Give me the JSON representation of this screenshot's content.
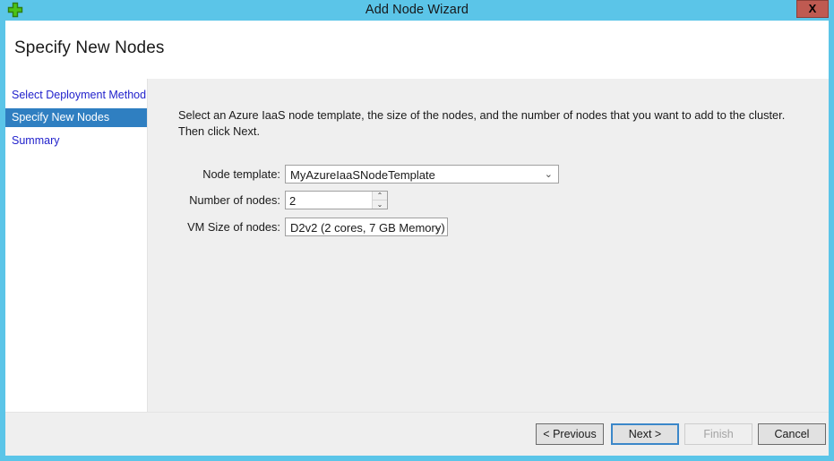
{
  "window": {
    "title": "Add Node Wizard",
    "icon": "green-plus-icon",
    "close_label": "X",
    "titlebar_color": "#5bc5e8",
    "close_button_color": "#bf5a51"
  },
  "header": {
    "page_title": "Specify New Nodes"
  },
  "sidebar": {
    "selected_index": 1,
    "highlight_color": "#2f7fc1",
    "link_color": "#2222cc",
    "items": [
      {
        "label": "Select Deployment Method"
      },
      {
        "label": "Specify New Nodes"
      },
      {
        "label": "Summary"
      }
    ]
  },
  "content": {
    "intro": "Select an Azure IaaS node template, the size of the nodes, and the number of nodes that you want to add to the cluster. Then click Next.",
    "fields": {
      "node_template": {
        "label": "Node template:",
        "value": "MyAzureIaaSNodeTemplate",
        "chevron": "⌄"
      },
      "number_of_nodes": {
        "label": "Number of nodes:",
        "value": "2",
        "up_glyph": "⌃",
        "down_glyph": "⌄"
      },
      "vm_size": {
        "label": "VM Size of nodes:",
        "value": "D2v2 (2 cores, 7 GB Memory)",
        "chevron": "⌄"
      }
    }
  },
  "footer": {
    "buttons": [
      {
        "label": "< Previous",
        "state": "enabled"
      },
      {
        "label": "Next >",
        "state": "focused"
      },
      {
        "label": "Finish",
        "state": "disabled"
      },
      {
        "label": "Cancel",
        "state": "enabled"
      }
    ]
  }
}
